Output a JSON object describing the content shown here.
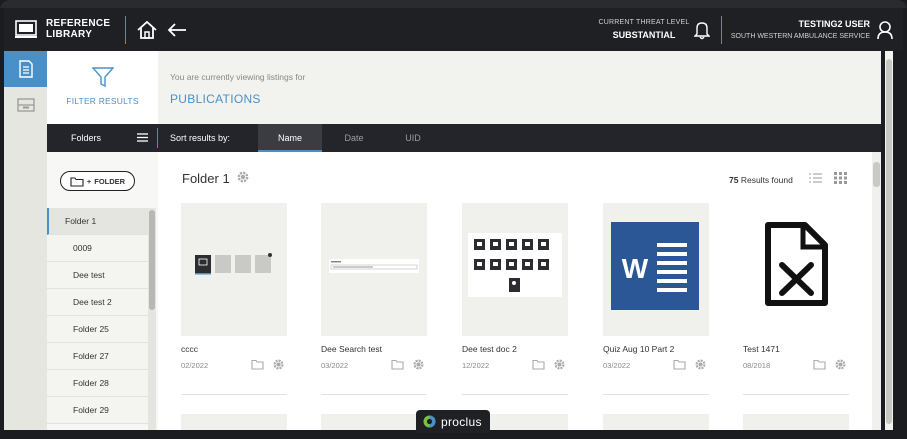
{
  "header": {
    "brand_line1": "REFERENCE",
    "brand_line2": "LIBRARY",
    "threat_label": "CURRENT THREAT LEVEL",
    "threat_value": "SUBSTANTIAL",
    "user_name": "TESTING2 USER",
    "user_org": "SOUTH WESTERN AMBULANCE SERVICE"
  },
  "filter": {
    "label": "FILTER RESULTS"
  },
  "intro": {
    "subtitle": "You are currently viewing listings for",
    "title": "PUBLICATIONS"
  },
  "sortbar": {
    "folders_label": "Folders",
    "sort_label": "Sort results by:",
    "tabs": [
      {
        "label": "Name",
        "active": true
      },
      {
        "label": "Date",
        "active": false
      },
      {
        "label": "UID",
        "active": false
      }
    ]
  },
  "sidebar": {
    "add_folder_label": "FOLDER",
    "add_folder_prefix": "+",
    "folders": [
      "Folder 1",
      "0009",
      "Dee test",
      "Dee test 2",
      "Folder 25",
      "Folder 27",
      "Folder 28",
      "Folder 29"
    ],
    "active_folder": "Folder 1"
  },
  "main": {
    "title": "Folder 1",
    "results_count": "75",
    "results_text": "Results found",
    "cards": [
      {
        "title": "cccc",
        "date": "02/2022",
        "thumb": "mini-grid"
      },
      {
        "title": "Dee Search test",
        "date": "03/2022",
        "thumb": "search-bar"
      },
      {
        "title": "Dee test doc 2",
        "date": "12/2022",
        "thumb": "app-grid"
      },
      {
        "title": "Quiz Aug 10 Part 2",
        "date": "03/2022",
        "thumb": "word"
      },
      {
        "title": "Test 1471",
        "date": "08/2018",
        "thumb": "excel"
      }
    ]
  },
  "footer": {
    "brand": "proclus"
  },
  "colors": {
    "accent": "#4a90c8",
    "topbar": "#1f2023",
    "word_blue": "#2b5797"
  }
}
